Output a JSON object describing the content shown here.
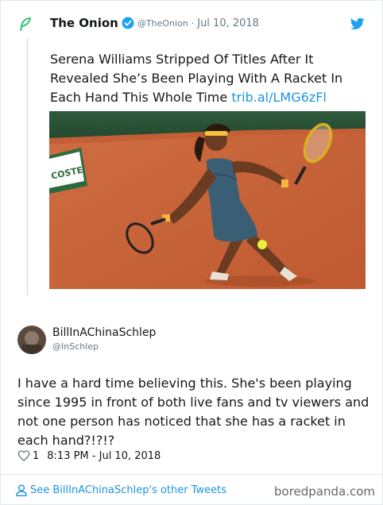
{
  "quoted_tweet": {
    "name": "The Onion",
    "handle": "@TheOnion",
    "separator": "·",
    "date": "Jul 10, 2018",
    "text": "Serena Williams Stripped Of Titles After It Revealed She’s Been Playing With A Racket In Each Hand This Whole Time ",
    "link": "trib.al/LMG6zFl",
    "banner_text": "COSTE",
    "photo_icon": "tennis-player-photo"
  },
  "reply_tweet": {
    "name": "BillInAChinaSchlep",
    "handle": "@InSchlep",
    "text": "I have a hard time believing this.  She's been playing since 1995 in front of both live fans and tv viewers and not one person has noticed that she has a racket in each hand?!?!?",
    "like_count": "1",
    "timestamp": "8:13 PM - Jul 10, 2018"
  },
  "footer": {
    "see_more": "See BillInAChinaSchlep's other Tweets",
    "watermark": "boredpanda.com"
  },
  "colors": {
    "link_blue": "#1b95e0",
    "verified_blue": "#1da1f2",
    "quote_icon_green": "#17bf63",
    "clay_court": "#c8643a"
  }
}
